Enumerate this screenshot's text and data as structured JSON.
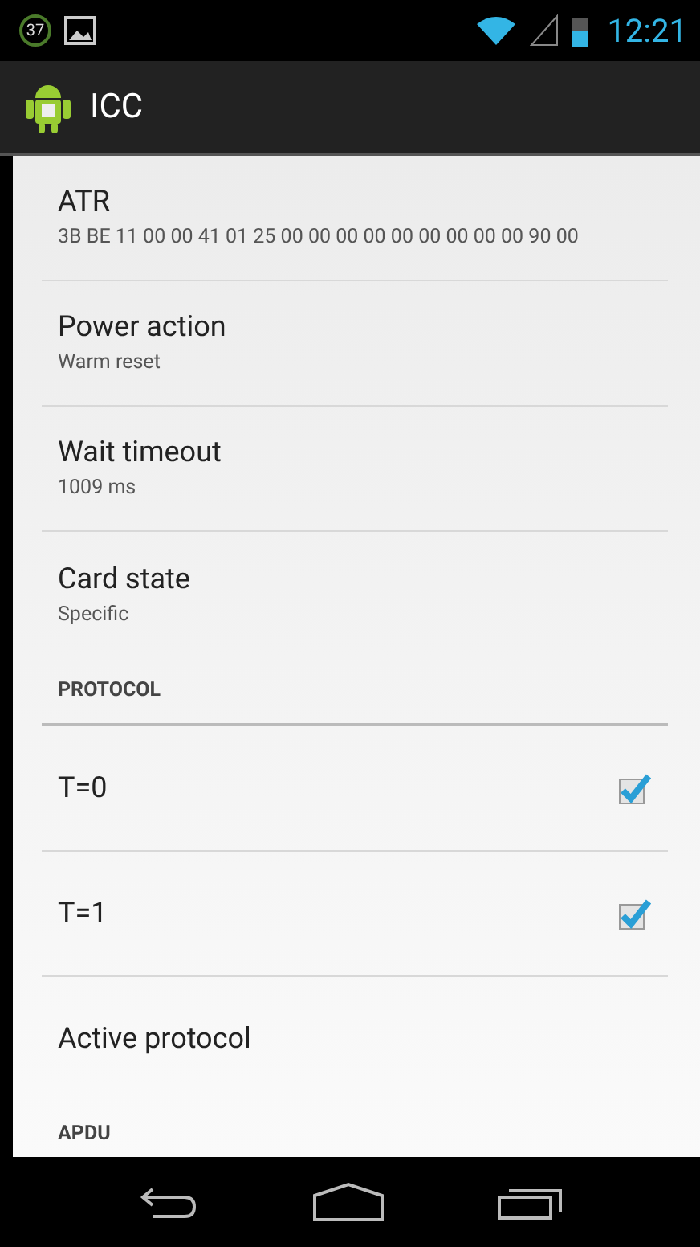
{
  "status_bar": {
    "notification_count": "37",
    "time": "12:21"
  },
  "action_bar": {
    "title": "ICC"
  },
  "items": [
    {
      "kind": "pref",
      "title": "ATR",
      "summary": "3B BE 11 00 00 41 01 25 00 00 00 00 00 00 00 00 00 90 00"
    },
    {
      "kind": "pref",
      "title": "Power action",
      "summary": "Warm reset"
    },
    {
      "kind": "pref",
      "title": "Wait timeout",
      "summary": "1009 ms"
    },
    {
      "kind": "pref",
      "title": "Card state",
      "summary": "Specific"
    },
    {
      "kind": "header",
      "title": "PROTOCOL"
    },
    {
      "kind": "check",
      "title": "T=0",
      "checked": true
    },
    {
      "kind": "check",
      "title": "T=1",
      "checked": true
    },
    {
      "kind": "pref",
      "title": "Active protocol"
    },
    {
      "kind": "header",
      "title": "APDU"
    }
  ]
}
